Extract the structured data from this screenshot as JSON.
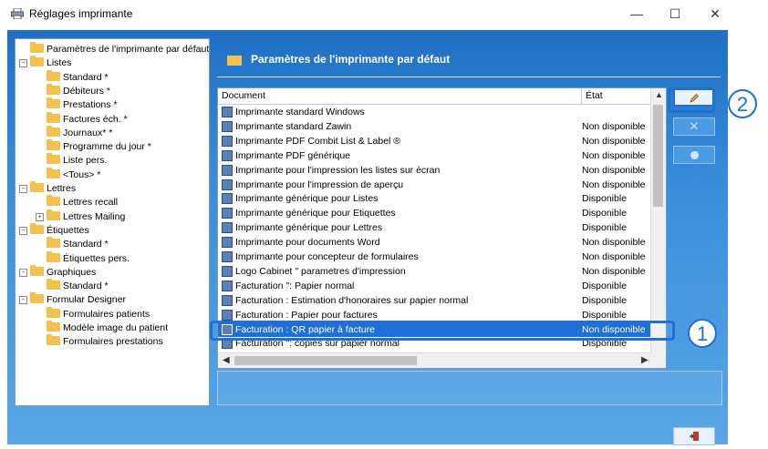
{
  "window": {
    "title": "Réglages imprimante",
    "min_label": "—",
    "max_label": "☐",
    "close_label": "✕"
  },
  "tree": [
    {
      "label": "Paramètres de l'imprimante par défaut"
    },
    {
      "label": "Listes",
      "expander": "−"
    },
    {
      "label": "Standard *"
    },
    {
      "label": "Débiteurs *"
    },
    {
      "label": "Prestations *"
    },
    {
      "label": "Factures éch. *"
    },
    {
      "label": "Journaux* *"
    },
    {
      "label": "Programme du jour *"
    },
    {
      "label": "Liste pers."
    },
    {
      "label": "<Tous> *"
    },
    {
      "label": "Lettres",
      "expander": "−"
    },
    {
      "label": "Lettres recall"
    },
    {
      "label": "Lettres Mailing",
      "expander": "+"
    },
    {
      "label": "Étiquettes",
      "expander": "−"
    },
    {
      "label": "Standard *"
    },
    {
      "label": "Étiquettes pers."
    },
    {
      "label": "Graphiques",
      "expander": "−"
    },
    {
      "label": "Standard *"
    },
    {
      "label": "Formular Designer",
      "expander": "−"
    },
    {
      "label": "Formulaires patients"
    },
    {
      "label": "Modèle image du patient"
    },
    {
      "label": "Formulaires prestations"
    }
  ],
  "panel": {
    "title": "Paramètres de l'imprimante par défaut"
  },
  "grid": {
    "columns": [
      "Document",
      "État"
    ],
    "rows": [
      {
        "document": "Imprimante standard Windows",
        "state": ""
      },
      {
        "document": "Imprimante standard Zawin",
        "state": "Non disponible"
      },
      {
        "document": "Imprimante PDF Combit List & Label ®",
        "state": "Non disponible"
      },
      {
        "document": "Imprimante PDF générique",
        "state": "Non disponible"
      },
      {
        "document": "Imprimante pour l'impression les listes sur écran",
        "state": "Non disponible"
      },
      {
        "document": "Imprimante pour l'impression de aperçu",
        "state": "Non disponible"
      },
      {
        "document": "Imprimante générique pour Listes",
        "state": "Disponible"
      },
      {
        "document": "Imprimante générique pour Etiquettes",
        "state": "Disponible"
      },
      {
        "document": "Imprimante générique pour Lettres",
        "state": "Disponible"
      },
      {
        "document": "Imprimante pour documents Word",
        "state": "Non disponible"
      },
      {
        "document": "Imprimante pour concepteur de formulaires",
        "state": "Non disponible"
      },
      {
        "document": "Logo Cabinet \" parametres d'impression",
        "state": "Non disponible"
      },
      {
        "document": "Facturation \": Papier normal",
        "state": "Disponible"
      },
      {
        "document": "Facturation : Estimation d'honoraires sur papier normal",
        "state": "Disponible"
      },
      {
        "document": "Facturation : Papier pour factures",
        "state": "Disponible"
      },
      {
        "document": "Facturation : QR papier à facture",
        "state": "Non disponible",
        "selected": true
      },
      {
        "document": "Facturation \": copies sur papier normal",
        "state": "Disponible"
      }
    ]
  },
  "callouts": [
    "1",
    "2"
  ],
  "colors": {
    "accent": "#1f6fd6",
    "window_bg": "#3a8fdc",
    "folder": "#f3c14e"
  },
  "icons": {
    "title": "printer-icon",
    "edit": "pencil-icon",
    "delete": "x-icon",
    "run": "play-icon",
    "exit": "exit-door-icon"
  }
}
